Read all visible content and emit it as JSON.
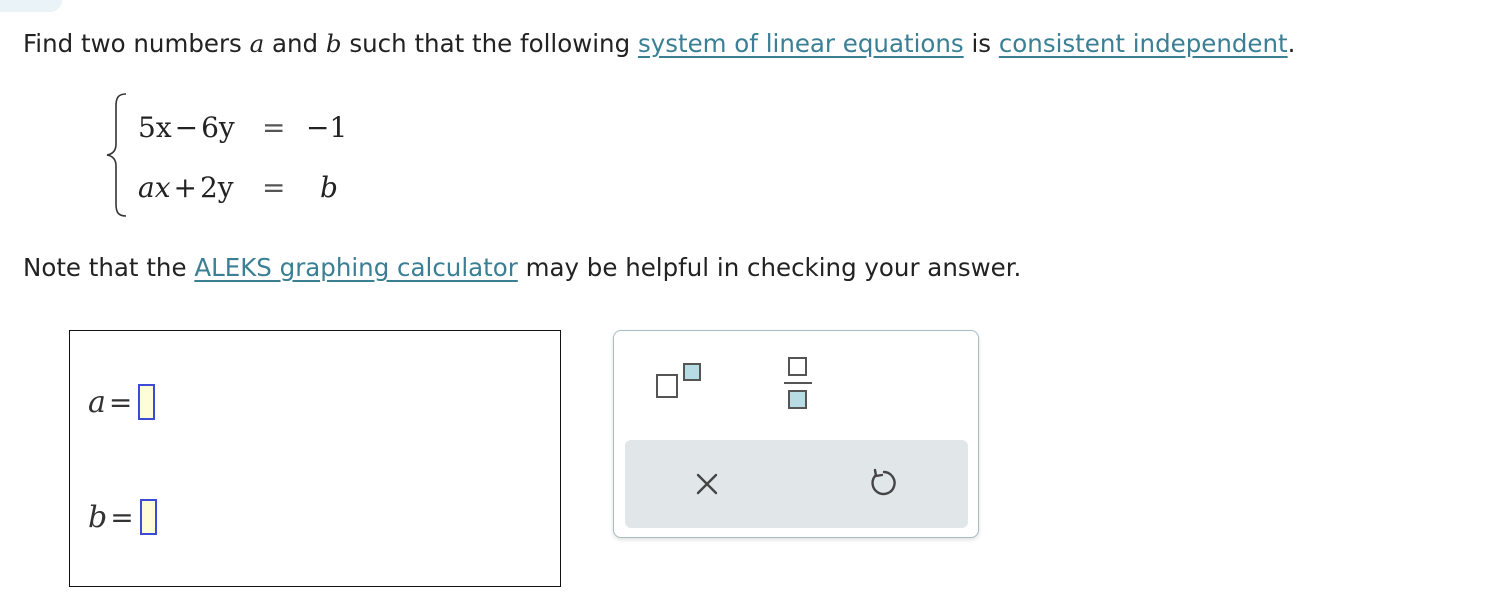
{
  "prompt": {
    "before_a": "Find two numbers",
    "var_a": "a",
    "and": "and",
    "var_b": "b",
    "middle": "such that the following",
    "link1": "system of linear equations",
    "is": "is",
    "link2": "consistent independent",
    "period": "."
  },
  "system": {
    "eq1": {
      "lhs_a": "5x",
      "lhs_op": "−",
      "lhs_b": "6y",
      "equals": "=",
      "rhs": "−1"
    },
    "eq2": {
      "lhs_a": "ax",
      "lhs_op": "+",
      "lhs_b": "2y",
      "equals": "=",
      "rhs": "b"
    }
  },
  "note": {
    "before": "Note that the",
    "link": "ALEKS graphing calculator",
    "after": "may be helpful in checking your answer."
  },
  "answers": {
    "a_label": "a",
    "b_label": "b",
    "equals": "=",
    "a_value": "",
    "b_value": ""
  },
  "palette": {
    "buttons": [
      "superscript-template",
      "fraction-template",
      "clear",
      "undo"
    ],
    "accent": "#3a7f94",
    "input_border": "#3b4bd8",
    "input_fill": "#fffcd8"
  }
}
